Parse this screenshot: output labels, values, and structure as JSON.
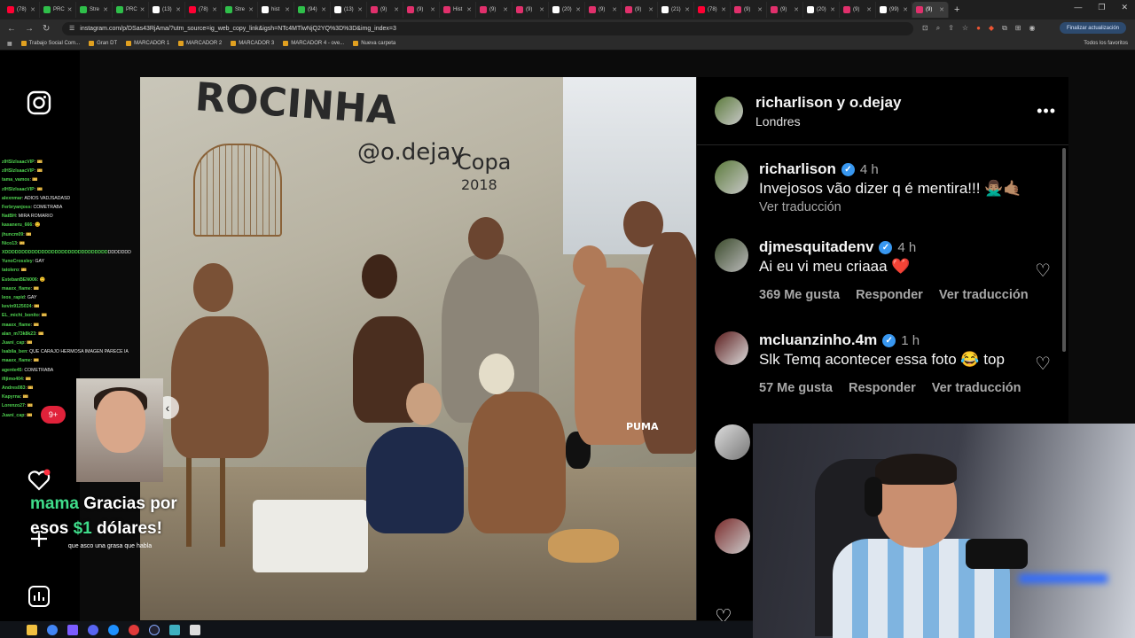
{
  "browser": {
    "tabs": [
      {
        "label": "(78)",
        "color": "#ff0033"
      },
      {
        "label": "PRC",
        "color": "#2fbf4a"
      },
      {
        "label": "Stre",
        "color": "#2fbf4a"
      },
      {
        "label": "PRC",
        "color": "#2fbf4a"
      },
      {
        "label": "(13)",
        "color": "#ffffff"
      },
      {
        "label": "(78)",
        "color": "#ff0033"
      },
      {
        "label": "Stre",
        "color": "#2fbf4a"
      },
      {
        "label": "hist",
        "color": "#ffffff"
      },
      {
        "label": "(94)",
        "color": "#2fbf4a"
      },
      {
        "label": "(13)",
        "color": "#ffffff"
      },
      {
        "label": "(9)",
        "color": "#e1306c"
      },
      {
        "label": "(9)",
        "color": "#e1306c"
      },
      {
        "label": "Hist",
        "color": "#e1306c"
      },
      {
        "label": "(9)",
        "color": "#e1306c"
      },
      {
        "label": "(9)",
        "color": "#e1306c"
      },
      {
        "label": "(20)",
        "color": "#ffffff"
      },
      {
        "label": "(9)",
        "color": "#e1306c"
      },
      {
        "label": "(9)",
        "color": "#e1306c"
      },
      {
        "label": "(21)",
        "color": "#ffffff"
      },
      {
        "label": "(78)",
        "color": "#ff0033"
      },
      {
        "label": "(9)",
        "color": "#e1306c"
      },
      {
        "label": "(9)",
        "color": "#e1306c"
      },
      {
        "label": "(20)",
        "color": "#ffffff"
      },
      {
        "label": "(9)",
        "color": "#e1306c"
      },
      {
        "label": "(99)",
        "color": "#ffffff"
      },
      {
        "label": "(9)",
        "color": "#e1306c"
      }
    ],
    "url": "instagram.com/p/DSas43RjAma/?utm_source=ig_web_copy_link&igsh=NTc4MTlwNjQ2YQ%3D%3D&img_index=3",
    "update_button": "Finalizar actualización",
    "bookmarks": [
      "Trabajo Social Com...",
      "Gran DT",
      "MARCADOR 1",
      "MARCADOR 2",
      "MARCADOR 3",
      "MARCADOR 4 - ove...",
      "Nueva carpeta"
    ],
    "all_favorites": "Todos los favoritos"
  },
  "chat": [
    {
      "user": "zlHSlzIsaacVIP",
      "msg": ": 🎫"
    },
    {
      "user": "zlHSlzIsaacVIP",
      "msg": ": 🎫"
    },
    {
      "user": "tama_vamos",
      "msg": ": 🎫"
    },
    {
      "user": "zlHSlzIsaacVIP",
      "msg": ": 🎫"
    },
    {
      "user": "alexnmar",
      "msg": ": ADIOS VADJSADASD"
    },
    {
      "user": "Ferbryanjoss",
      "msg": ": COMETRABA"
    },
    {
      "user": "NatBH",
      "msg": ": MIRA ROMARIO"
    },
    {
      "user": "kasaneru_666",
      "msg": ": 😊"
    },
    {
      "user": "jhuncm09",
      "msg": ": 🎫"
    },
    {
      "user": "Nico13",
      "msg": ": 🎫"
    },
    {
      "user": "XDDDDDDDDDDDDDDDDDDDDDDDDDDDDDDD",
      "msg": "DDDDDDD"
    },
    {
      "user": "YunoCrossley",
      "msg": ": GAY"
    },
    {
      "user": "tatolero",
      "msg": ": 🎫"
    },
    {
      "user": "EstebanBEN006",
      "msg": ": 😊"
    },
    {
      "user": "maaxx_flame",
      "msg": ": 🎫"
    },
    {
      "user": "leos_rapid",
      "msg": ": GAY"
    },
    {
      "user": "kevin9125024",
      "msg": ": 🎫"
    },
    {
      "user": "EL_michi_bonito",
      "msg": ": 🎫"
    },
    {
      "user": "maaxx_flame",
      "msg": ": 🎫"
    },
    {
      "user": "alan_m73k8k23",
      "msg": ": 🎫"
    },
    {
      "user": "Juani_cap",
      "msg": ": 🎫"
    },
    {
      "user": "Isabila_ben",
      "msg": ": QUE CARAJO HERMOSA IMAGEN PARECE IA"
    },
    {
      "user": "maaxx_flame",
      "msg": ": 🎫"
    },
    {
      "user": "agente45",
      "msg": ": COMETRABA"
    },
    {
      "user": "ifijimo404",
      "msg": ": 🎫"
    },
    {
      "user": "Andres083",
      "msg": ": 🎫"
    },
    {
      "user": "Kapyrna",
      "msg": ": 🎫"
    },
    {
      "user": "Lorenzo27",
      "msg": ": 🎫"
    },
    {
      "user": "Juani_cap",
      "msg": ": 🎫"
    }
  ],
  "notification_badge": "9+",
  "donation": {
    "name": "mama",
    "text1": " Gracias por",
    "text2a": "esos ",
    "amount": "$1",
    "text2b": " dólares!",
    "message": "que asco una grasa que habla"
  },
  "photo": {
    "graffiti_main": "ROCINHA",
    "graffiti_handle": "@o.dejay",
    "graffiti_copa": "Copa",
    "graffiti_year": "2018",
    "puma": "PUMA",
    "nav_prev": "‹"
  },
  "post": {
    "header_title": "richarlison y o.dejay",
    "header_location": "Londres",
    "more": "•••",
    "comments": [
      {
        "user": "richarlison",
        "verified": true,
        "time": "4 h",
        "text": "Invejosos vão dizer q é mentira!!! 🙅🏽‍♂️🤙🏽",
        "likes": "",
        "reply": "",
        "translate": "Ver traducción"
      },
      {
        "user": "djmesquitadenv",
        "verified": true,
        "time": "4 h",
        "text": "Ai eu vi meu criaaa ❤️",
        "likes": "369 Me gusta",
        "reply": "Responder",
        "translate": "Ver traducción"
      },
      {
        "user": "mcluanzinho.4m",
        "verified": true,
        "time": "1 h",
        "text": "Slk Temq acontecer essa foto 😂 top",
        "likes": "57 Me gusta",
        "reply": "Responder",
        "translate": "Ver traducción"
      }
    ]
  },
  "colors": {
    "instagram_bg": "#000000",
    "verified_blue": "#3897f0",
    "donation_green": "#3fdc8a",
    "heart_red": "#ff3040"
  }
}
